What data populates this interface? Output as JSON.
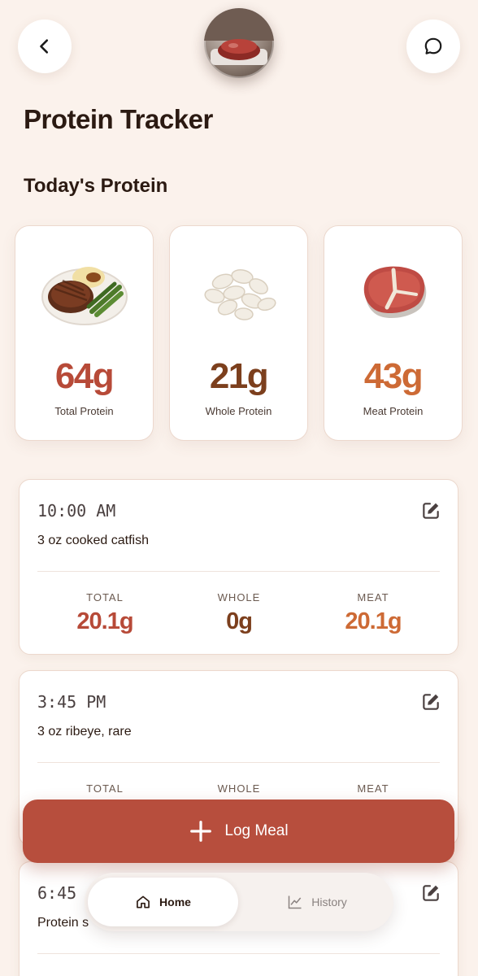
{
  "header": {
    "back_icon": "chevron-left-icon",
    "chat_icon": "chat-bubble-icon",
    "avatar": "steak-photo"
  },
  "page_title": "Protein Tracker",
  "section_title": "Today's Protein",
  "summary": [
    {
      "value": "64g",
      "label": "Total Protein",
      "illustration": "steak-plate",
      "color": "#b74a38"
    },
    {
      "value": "21g",
      "label": "Whole Protein",
      "illustration": "white-beans",
      "color": "#7c3f1d"
    },
    {
      "value": "43g",
      "label": "Meat Protein",
      "illustration": "t-bone-steak",
      "color": "#cd6a35"
    }
  ],
  "meals": [
    {
      "time": "10:00 AM",
      "description": "3 oz cooked catfish",
      "total_label": "TOTAL",
      "total": "20.1g",
      "whole_label": "WHOLE",
      "whole": "0g",
      "meat_label": "MEAT",
      "meat": "20.1g"
    },
    {
      "time": "3:45 PM",
      "description": "3 oz ribeye, rare",
      "total_label": "TOTAL",
      "whole_label": "WHOLE",
      "meat_label": "MEAT"
    },
    {
      "time": "6:45",
      "description": "Protein s"
    }
  ],
  "log_button": {
    "label": "Log Meal",
    "icon": "plus-icon"
  },
  "nav": {
    "home_label": "Home",
    "history_label": "History",
    "home_icon": "home-icon",
    "history_icon": "chart-line-icon"
  },
  "colors": {
    "background": "#fbf2ec",
    "accent": "#b74e3d",
    "total": "#b74a38",
    "whole": "#7c3f1d",
    "meat": "#cd6a35"
  }
}
